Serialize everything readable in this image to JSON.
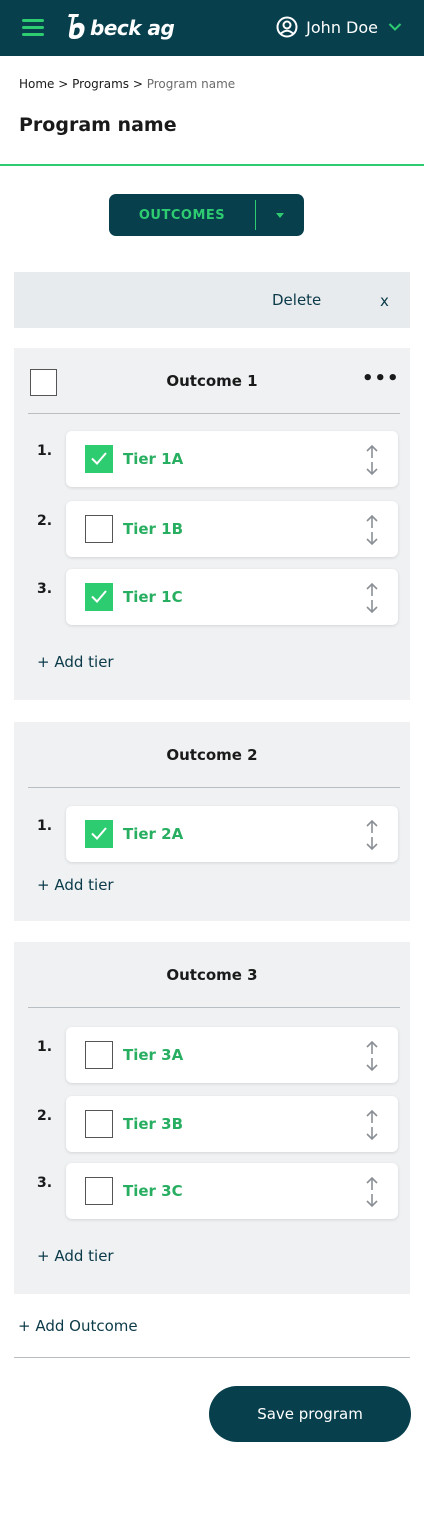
{
  "header": {
    "logo_text": "beck ag",
    "user_name": "John Doe"
  },
  "breadcrumb": {
    "home": "Home",
    "sep1": " > ",
    "programs": "Programs",
    "sep2": " > ",
    "current": "Program name"
  },
  "page_title": "Program name",
  "view_selector": {
    "label": "OUTCOMES"
  },
  "selection_bar": {
    "delete_label": "Delete",
    "close_label": "x"
  },
  "outcomes": [
    {
      "title": "Outcome 1",
      "more_label": "•••",
      "tiers": [
        {
          "num": "1.",
          "label": "Tier 1A",
          "checked": true
        },
        {
          "num": "2.",
          "label": "Tier 1B",
          "checked": false
        },
        {
          "num": "3.",
          "label": "Tier 1C",
          "checked": true
        }
      ],
      "add_tier_label": "+ Add tier"
    },
    {
      "title": "Outcome 2",
      "tiers": [
        {
          "num": "1.",
          "label": "Tier 2A",
          "checked": true
        }
      ],
      "add_tier_label": "+ Add tier"
    },
    {
      "title": "Outcome 3",
      "tiers": [
        {
          "num": "1.",
          "label": "Tier 3A",
          "checked": false
        },
        {
          "num": "2.",
          "label": "Tier 3B",
          "checked": false
        },
        {
          "num": "3.",
          "label": "Tier 3C",
          "checked": false
        }
      ],
      "add_tier_label": "+ Add tier"
    }
  ],
  "add_outcome_label": "+ Add Outcome",
  "save_label": "Save program",
  "colors": {
    "brand_dark": "#073f4d",
    "accent_green": "#2ecc71",
    "tier_text_green": "#27ae60"
  }
}
